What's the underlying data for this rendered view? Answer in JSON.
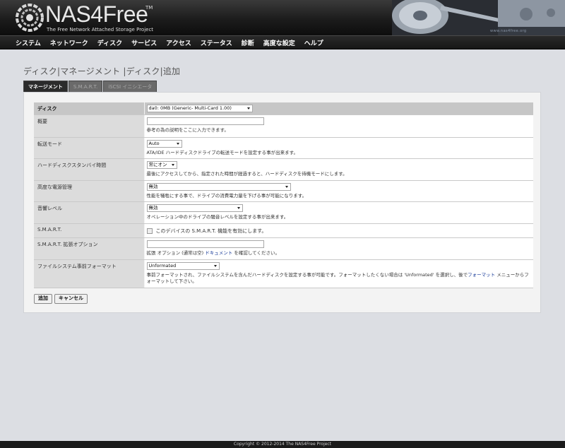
{
  "header": {
    "brand": "NAS4Free",
    "trademark": "TM",
    "tagline": "The Free Network Attached Storage Project",
    "watermark": "www.nas4free.org"
  },
  "nav": [
    "システム",
    "ネットワーク",
    "ディスク",
    "サービス",
    "アクセス",
    "ステータス",
    "診断",
    "高度な設定",
    "ヘルプ"
  ],
  "page_title": "ディスク|マネージメント |ディスク|追加",
  "tabs": [
    {
      "label": "マネージメント",
      "active": true
    },
    {
      "label": "S.M.A.R.T.",
      "active": false
    },
    {
      "label": "iSCSI イニシエータ",
      "active": false
    }
  ],
  "form": {
    "disk": {
      "label": "ディスク",
      "value": "da0: 0MB (Generic- Multi-Card 1.00)"
    },
    "description": {
      "label": "概要",
      "value": "",
      "help": "参考の為の説明をここに入力できます。"
    },
    "transfer_mode": {
      "label": "転送モード",
      "value": "Auto",
      "help": "ATA/IDE ハードディスクドライブの転送モードを設定する事が出来ます。"
    },
    "standby": {
      "label": "ハードディスクスタンバイ時間",
      "value": "常にオン",
      "help": "最後にアクセスしてから、指定された時間が経過すると、ハードディスクを待機モードにします。"
    },
    "apm": {
      "label": "高度な電源管理",
      "value": "無効",
      "help": "性能を犠牲にする事で、ドライブの消費電力量を下げる事が可能になります。"
    },
    "acoustic": {
      "label": "音響レベル",
      "value": "無効",
      "help": "オペレーション中のドライブの騒音レベルを設定する事が出来ます。"
    },
    "smart": {
      "label": "S.M.A.R.T.",
      "checkbox_label": "このデバイスの S.M.A.R.T. 機能を有効にします。",
      "checked": false
    },
    "smart_ext": {
      "label": "S.M.A.R.T. 拡張オプション",
      "value": "",
      "help_pre": "拡張 オプション (通常は空) ",
      "help_link": "ドキュメント",
      "help_post": " を確認してください。"
    },
    "preformat": {
      "label": "ファイルシステム事前フォーマット",
      "value": "Unformated",
      "help_pre": "事前フォーマットされ、ファイルシステムを含んだハードディスクを設定する事が可能です。フォーマットしたくない場合は 'Unformated' を選択し、後で",
      "help_link": "フォーマット",
      "help_post": " メニューからフォーマットして下さい。"
    }
  },
  "buttons": {
    "add": "追加",
    "cancel": "キャンセル"
  },
  "footer": "Copyright © 2012-2014 The NAS4Free Project"
}
